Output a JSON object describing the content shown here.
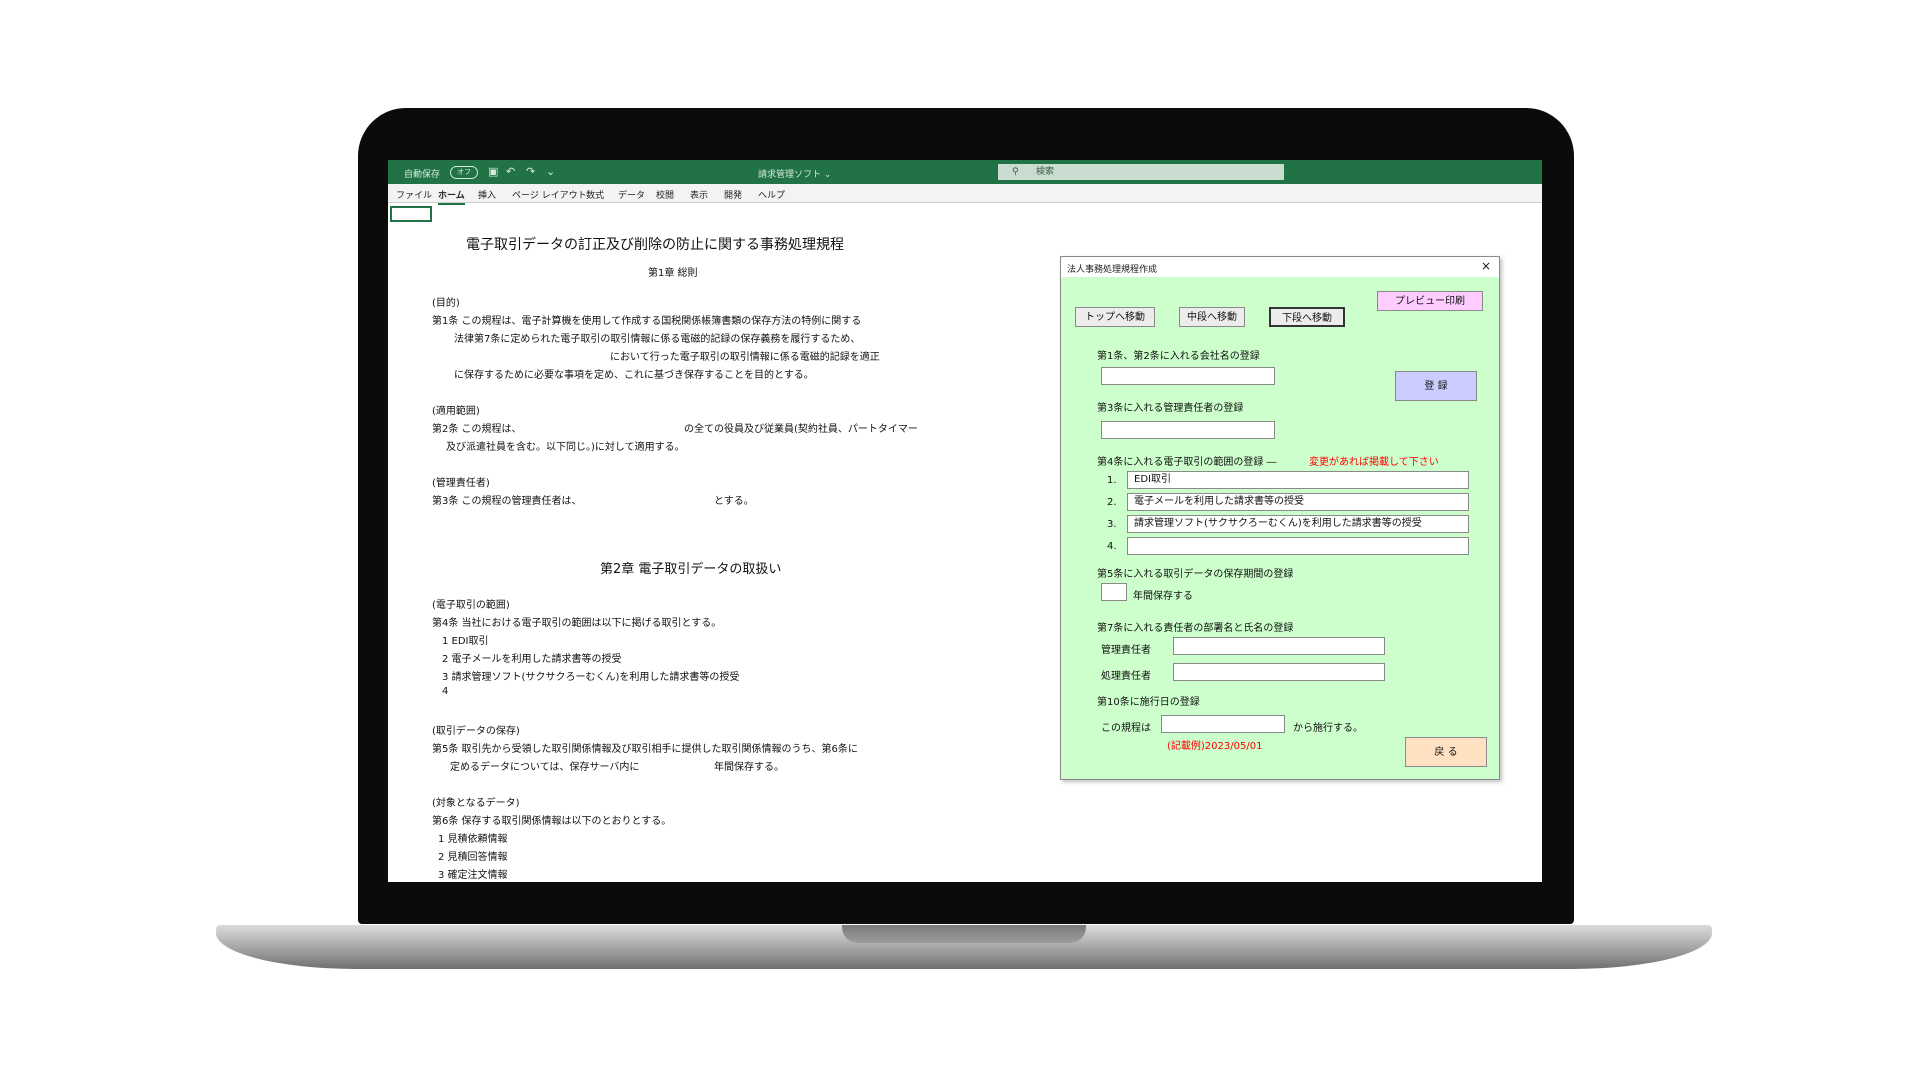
{
  "excel": {
    "autosave_label": "自動保存",
    "autosave_state": "オフ",
    "window_title": "請求管理ソフト ⌄",
    "search_placeholder": "検索",
    "tabs": [
      "ファイル",
      "ホーム",
      "挿入",
      "ページ レイアウト",
      "数式",
      "データ",
      "校閲",
      "表示",
      "開発",
      "ヘルプ"
    ],
    "active_tab": "ホーム"
  },
  "document": {
    "title": "電子取引データの訂正及び削除の防止に関する事務処理規程",
    "chapter1": "第1章 総則",
    "purpose_heading": "(目的)",
    "art1_line1": "第1条 この規程は、電子計算機を使用して作成する国税関係帳簿書類の保存方法の特例に関する",
    "art1_line2": "法律第7条に定められた電子取引の取引情報に係る電磁的記録の保存義務を履行するため、",
    "art1_line3": "において行った電子取引の取引情報に係る電磁的記録を適正",
    "art1_line4": "に保存するために必要な事項を定め、これに基づき保存することを目的とする。",
    "scope_heading": "(適用範囲)",
    "art2_line1a": "第2条 この規程は、",
    "art2_line1b": "の全ての役員及び従業員(契約社員、パートタイマー",
    "art2_line2": "及び派遣社員を含む。以下同じ。)に対して適用する。",
    "manager_heading": "(管理責任者)",
    "art3_a": "第3条 この規程の管理責任者は、",
    "art3_b": "とする。",
    "chapter2": "第2章 電子取引データの取扱い",
    "scope2_heading": "(電子取引の範囲)",
    "art4": "第4条 当社における電子取引の範囲は以下に掲げる取引とする。",
    "art4_items": [
      "1 EDI取引",
      "2 電子メールを利用した請求書等の授受",
      "3 請求管理ソフト(サクサクろーむくん)を利用した請求書等の授受",
      "4"
    ],
    "storage_heading": "(取引データの保存)",
    "art5_line1": "第5条 取引先から受領した取引関係情報及び取引相手に提供した取引関係情報のうち、第6条に",
    "art5_line2a": "定めるデータについては、保存サーバ内に",
    "art5_line2b": "年間保存する。",
    "target_heading": "(対象となるデータ)",
    "art6": "第6条 保存する取引関係情報は以下のとおりとする。",
    "art6_items": [
      "1 見積依頼情報",
      "2 見積回答情報",
      "3 確定注文情報"
    ]
  },
  "dialog": {
    "title": "法人事務処理規程作成",
    "close": "×",
    "nav_top": "トップへ移動",
    "nav_middle": "中段へ移動",
    "nav_bottom": "下段へ移動",
    "preview_print": "プレビュー印刷",
    "company_label": "第1条、第2条に入れる会社名の登録",
    "company_value": "",
    "register": "登 録",
    "manager_label": "第3条に入れる管理責任者の登録",
    "manager_value": "",
    "range_label": "第4条に入れる電子取引の範囲の登録 ―",
    "range_note": "変更があれば掲載して下さい",
    "range_items": [
      {
        "num": "1.",
        "value": "EDI取引"
      },
      {
        "num": "2.",
        "value": "電子メールを利用した請求書等の授受"
      },
      {
        "num": "3.",
        "value": "請求管理ソフト(サクサクろーむくん)を利用した請求書等の授受"
      },
      {
        "num": "4.",
        "value": ""
      }
    ],
    "period_label": "第5条に入れる取引データの保存期間の登録",
    "period_value": "",
    "period_suffix": "年間保存する",
    "dept_label": "第7条に入れる責任者の部署名と氏名の登録",
    "mgr_resp_label": "管理責任者",
    "mgr_resp_value": "",
    "proc_resp_label": "処理責任者",
    "proc_resp_value": "",
    "effective_label": "第10条に施行日の登録",
    "effective_prefix": "この規程は",
    "effective_value": "",
    "effective_suffix": "から施行する。",
    "example": "(記載例)2023/05/01",
    "back": "戻 る"
  },
  "colors": {
    "excel_green": "#217346",
    "dialog_bg": "#ccffcc",
    "preview_btn": "#ffccff",
    "register_btn": "#ccccff",
    "back_btn": "#ffe0c0",
    "note_red": "#ff0000"
  }
}
